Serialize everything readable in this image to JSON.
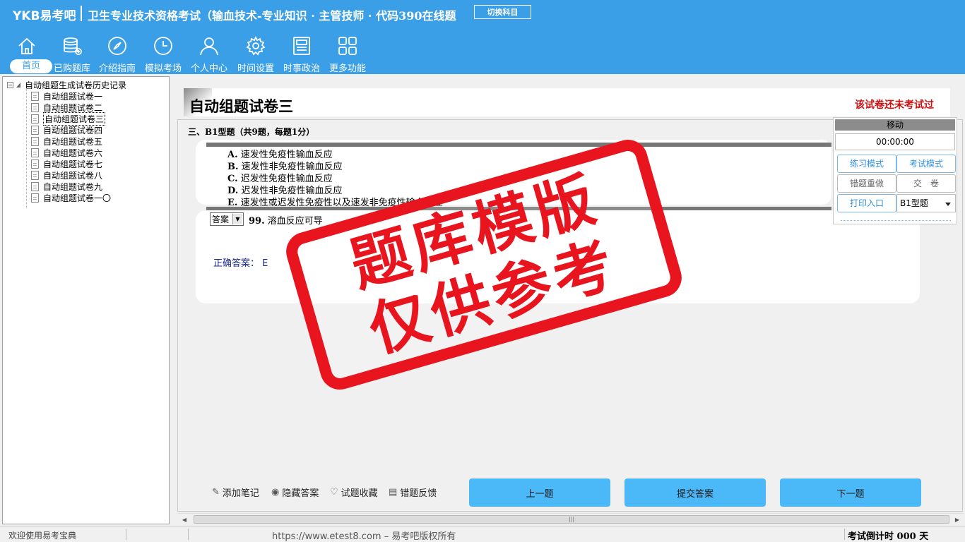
{
  "header": {
    "brand": "YKB易考吧",
    "exam_title": "卫生专业技术资格考试（输血技术-专业知识 · 主管技师 · 代码390在线题",
    "switch_label": "切换科目"
  },
  "nav": [
    {
      "label": "首页",
      "icon": "home-icon"
    },
    {
      "label": "已购题库",
      "icon": "database-icon"
    },
    {
      "label": "介绍指南",
      "icon": "compass-icon"
    },
    {
      "label": "模拟考场",
      "icon": "clock-icon"
    },
    {
      "label": "个人中心",
      "icon": "user-icon"
    },
    {
      "label": "时间设置",
      "icon": "gear-icon"
    },
    {
      "label": "时事政治",
      "icon": "newspaper-icon"
    },
    {
      "label": "更多功能",
      "icon": "grid-icon"
    }
  ],
  "tree": {
    "root": "自动组题生成试卷历史记录",
    "items": [
      "自动组题试卷一",
      "自动组题试卷二",
      "自动组题试卷三",
      "自动组题试卷四",
      "自动组题试卷五",
      "自动组题试卷六",
      "自动组题试卷七",
      "自动组题试卷八",
      "自动组题试卷九",
      "自动组题试卷一〇"
    ],
    "selected_index": 2
  },
  "paper": {
    "title": "自动组题试卷三",
    "status": "该试卷还未考试过",
    "section_title": "三、B1型题（共9题，每题1分）"
  },
  "options": [
    {
      "key": "A.",
      "text": "速发性免疫性输血反应"
    },
    {
      "key": "B.",
      "text": "速发性非免疫性输血反应"
    },
    {
      "key": "C.",
      "text": "迟发性免疫性输血反应"
    },
    {
      "key": "D.",
      "text": "迟发性非免疫性输血反应"
    },
    {
      "key": "E.",
      "text": "速发性或迟发性免疫性以及速发非免疫性输血反应"
    }
  ],
  "question": {
    "answer_select": "答案",
    "number": "99.",
    "text": "溶血反应可导",
    "correct_label": "正确答案：",
    "correct_value": "E"
  },
  "float_panel": {
    "move_label": "移动",
    "timer": "00:00:00",
    "practice_mode": "练习模式",
    "exam_mode": "考试模式",
    "redo_wrong": "错题重做",
    "submit_paper": "交　卷",
    "print_entry": "打印入口",
    "type_select": "B1型题"
  },
  "tools": {
    "add_note": "添加笔记",
    "hide_answer": "隐藏答案",
    "favorite": "试题收藏",
    "feedback": "错题反馈"
  },
  "buttons": {
    "prev": "上一题",
    "submit": "提交答案",
    "next": "下一题"
  },
  "statusbar": {
    "welcome": "欢迎使用易考宝典",
    "url": "https://www.etest8.com – 易考吧版权所有",
    "countdown": "考试倒计时 000 天"
  },
  "watermark": {
    "line1": "题库模版",
    "line2": "仅供参考",
    "color": "#e8141e"
  },
  "colors": {
    "header_bg": "#3b9fe8",
    "button_bg": "#4bb8f8",
    "status_red": "#cc1010"
  }
}
